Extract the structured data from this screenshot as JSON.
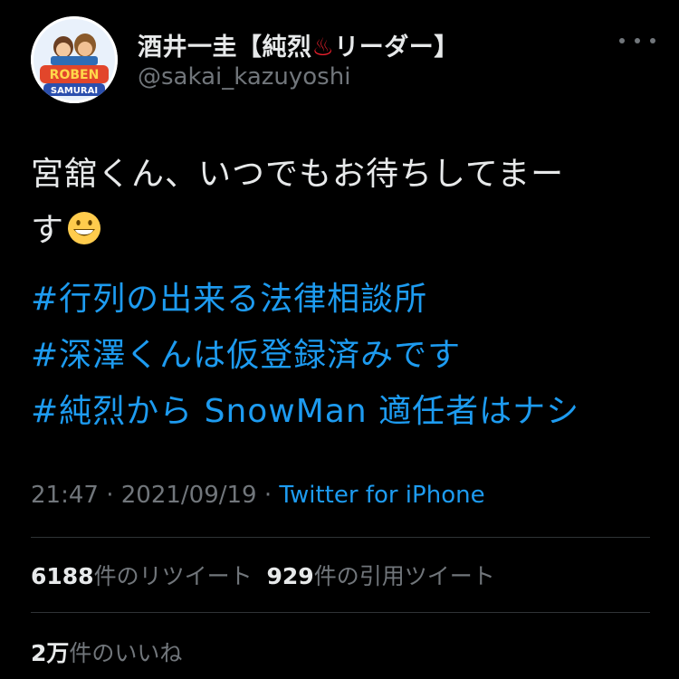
{
  "author": {
    "display_name_prefix": "酒井一圭【純烈",
    "hot_spring_symbol": "♨",
    "display_name_suffix": "リーダー】",
    "handle": "@sakai_kazuyoshi",
    "avatar_text_top": "ROBEN",
    "avatar_text_bottom": "SAMURAI"
  },
  "tweet": {
    "line1": "宮舘くん、いつでもお待ちしてまー",
    "line2": "す",
    "emoji": "grinning-face",
    "hashtags": [
      "#行列の出来る法律相談所",
      "#深澤くんは仮登録済みです",
      "#純烈から SnowMan 適任者はナシ"
    ]
  },
  "meta": {
    "time": "21:47",
    "date": "2021/09/19",
    "separator": "·",
    "source": "Twitter for iPhone"
  },
  "stats": {
    "retweets_count": "6188",
    "retweets_label": "件のリツイート",
    "quotes_count": "929",
    "quotes_label": "件の引用ツイート",
    "likes_count": "2万",
    "likes_label": "件のいいね"
  },
  "colors": {
    "background": "#000000",
    "text": "#e7e9ea",
    "secondary": "#71767b",
    "link": "#1d9bf0",
    "divider": "#2f3336"
  }
}
